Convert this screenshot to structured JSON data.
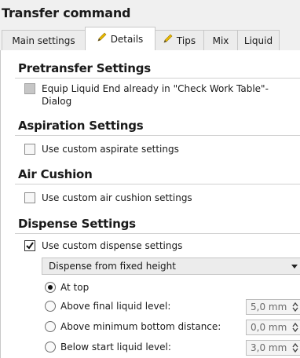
{
  "title": "Transfer command",
  "tabs": [
    {
      "label": "Main settings",
      "active": false,
      "icon": null
    },
    {
      "label": "Details",
      "active": true,
      "icon": "pencil-icon"
    },
    {
      "label": "Tips",
      "active": false,
      "icon": "pencil-icon"
    },
    {
      "label": "Mix",
      "active": false,
      "icon": null
    },
    {
      "label": "Liquid",
      "active": false,
      "icon": null
    }
  ],
  "sections": {
    "pretransfer": {
      "heading": "Pretransfer Settings",
      "checkbox_label_line1": "Equip Liquid End already in \"Check Work Table\"-",
      "checkbox_label_line2": "Dialog",
      "checked": false,
      "disabled": true
    },
    "aspiration": {
      "heading": "Aspiration Settings",
      "checkbox_label": "Use custom aspirate settings",
      "checked": false
    },
    "air_cushion": {
      "heading": "Air Cushion",
      "checkbox_label": "Use custom air cushion settings",
      "checked": false
    },
    "dispense": {
      "heading": "Dispense Settings",
      "checkbox_label": "Use custom dispense settings",
      "checked": true,
      "mode_select": "Dispense from fixed height",
      "options": [
        {
          "label": "At top",
          "selected": true,
          "value": null
        },
        {
          "label": "Above final liquid level:",
          "selected": false,
          "value": "5,0 mm"
        },
        {
          "label": "Above minimum bottom distance:",
          "selected": false,
          "value": "0,0 mm"
        },
        {
          "label": "Below start liquid level:",
          "selected": false,
          "value": "3,0 mm"
        }
      ]
    }
  },
  "colors": {
    "pencil": "#e8b900",
    "panel": "#ffffff",
    "chrome": "#f0f0f0"
  }
}
